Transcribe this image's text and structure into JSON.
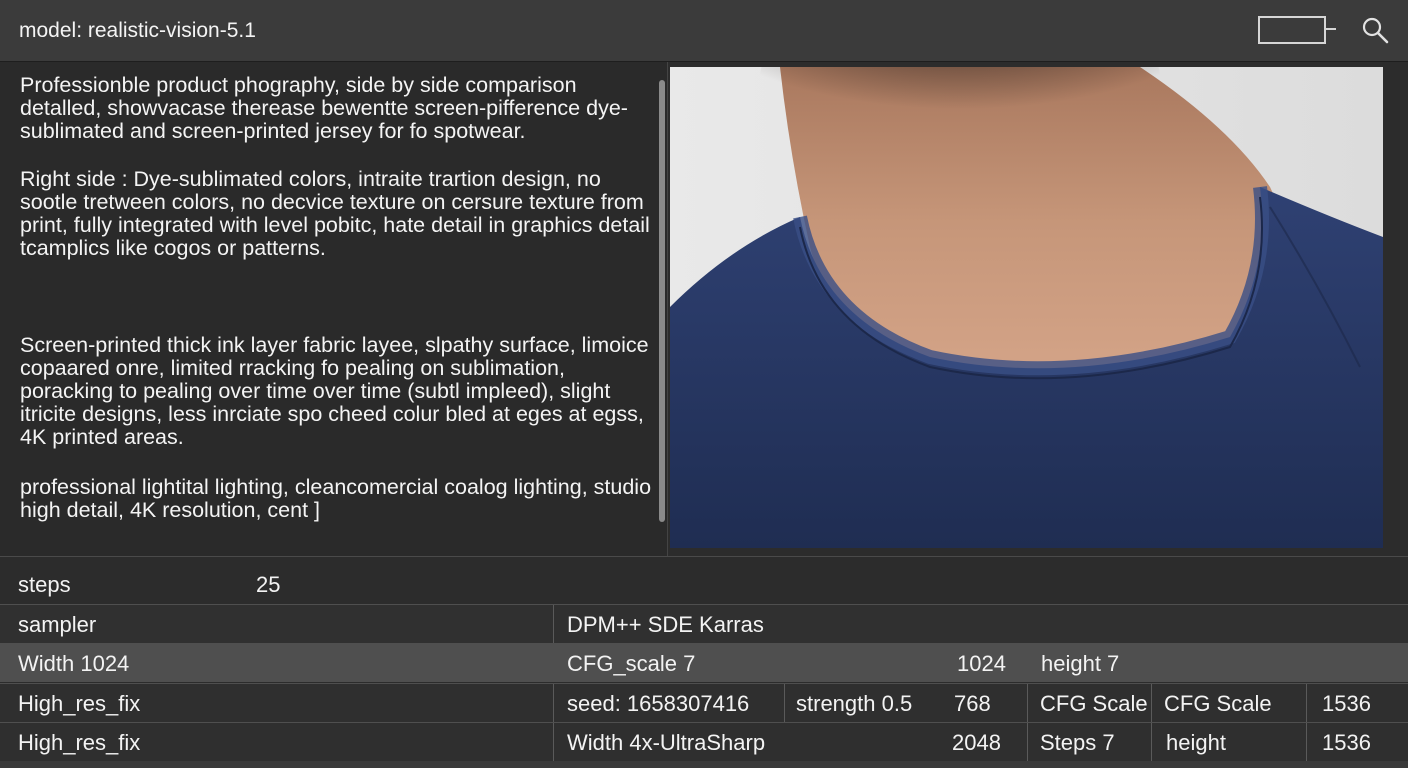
{
  "header": {
    "model_label": "model: realistic-vision-5.1",
    "toggle_icon": "toggle-icon",
    "search_icon": "search-icon"
  },
  "prompt": {
    "paragraphs": [
      "Professionble product phography, side by side comparison detalled, showvacase therease bewentte screen-pifference dye-sublimated and screen-printed jersey for fo spotwear.",
      "Right side : Dye-sublimated colors, intraite trartion design, no sootle tretween colors, no decvice texture on cersure texture from print, fully integrated with level pobitc, hate detail in graphics detail  tcamplics like cogos  or patterns.",
      "Screen-printed thick ink layer fabric layee, slpathy surface, limoice copaared onre, limited rracking fo pealing on sublimation, poracking to pealing over time over time (subtl impleed), slight itricite designs, less inrciate spo cheed colur bled at eges at egss, 4K printed areas.",
      "professional lightital lighting, cleancomercial coalog lighting, studio  high detail, 4K resolution, cent ]"
    ]
  },
  "preview": {
    "colors": {
      "shirt": "#2a3a66",
      "skin": "#c99a7e",
      "backdrop": "#e6e6e6"
    }
  },
  "params": {
    "steps": {
      "label": "steps",
      "value": "25"
    },
    "sampler": {
      "label": "sampler",
      "value": "DPM++ SDE Karras"
    },
    "width_row": {
      "width": "Width  1024",
      "cfg": "CFG_scale 7",
      "value": "1024",
      "height": "height 7"
    },
    "hires_row_1": {
      "label": "High_res_fix",
      "seed": "seed:  1658307416",
      "strength": "strength 0.5",
      "value": "768",
      "cfg_a": "CFG Scale",
      "cfg_b": "CFG Scale",
      "value2": "1536"
    },
    "hires_row_2": {
      "label": "High_res_fix",
      "upscaler": "Width 4x-UltraSharp",
      "value": "2048",
      "steps": "Steps   7",
      "height": "height",
      "value2": "1536"
    }
  }
}
